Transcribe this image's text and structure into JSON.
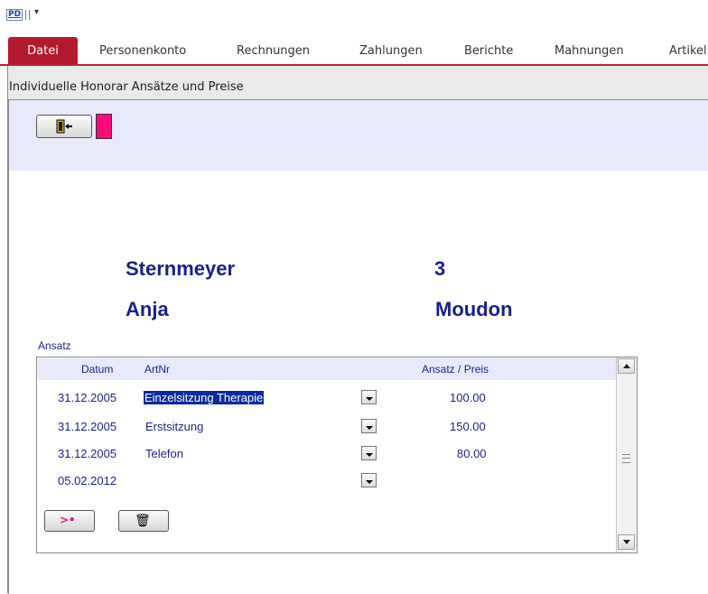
{
  "qat": {
    "logo": "PD",
    "dropdown_glyph": "▾"
  },
  "ribbon": {
    "file_tab": "Datei",
    "tabs": [
      "Personenkonto",
      "Rechnungen",
      "Zahlungen",
      "Berichte",
      "Mahnungen",
      "Artikel"
    ]
  },
  "form": {
    "title": "Individuelle Honorar Ansätze und Preise"
  },
  "person": {
    "lastname": "Sternmeyer",
    "number": "3",
    "firstname": "Anja",
    "city": "Moudon"
  },
  "subform": {
    "label": "Ansatz",
    "columns": {
      "datum": "Datum",
      "artnr": "ArtNr",
      "preis": "Ansatz / Preis"
    },
    "rows": [
      {
        "datum": "31.12.2005",
        "artnr": "Einzelsitzung Therapie",
        "preis": "100.00"
      },
      {
        "datum": "31.12.2005",
        "artnr": "Erstsitzung",
        "preis": "150.00"
      },
      {
        "datum": "31.12.2005",
        "artnr": "Telefon",
        "preis": "80.00"
      },
      {
        "datum": "05.02.2012",
        "artnr": "",
        "preis": ""
      }
    ],
    "new_glyph": ">•",
    "delete_glyph": "🗑"
  },
  "colors": {
    "accent": "#b31a2e",
    "text_blue": "#1b1f8a",
    "band": "#e8eafb",
    "pink": "#ff0a7a",
    "selection": "#0a2a9e"
  },
  "icons": [
    "door-exit-icon",
    "new-record-icon",
    "trash-icon",
    "chevron-down-icon",
    "scroll-up-icon",
    "scroll-down-icon"
  ]
}
